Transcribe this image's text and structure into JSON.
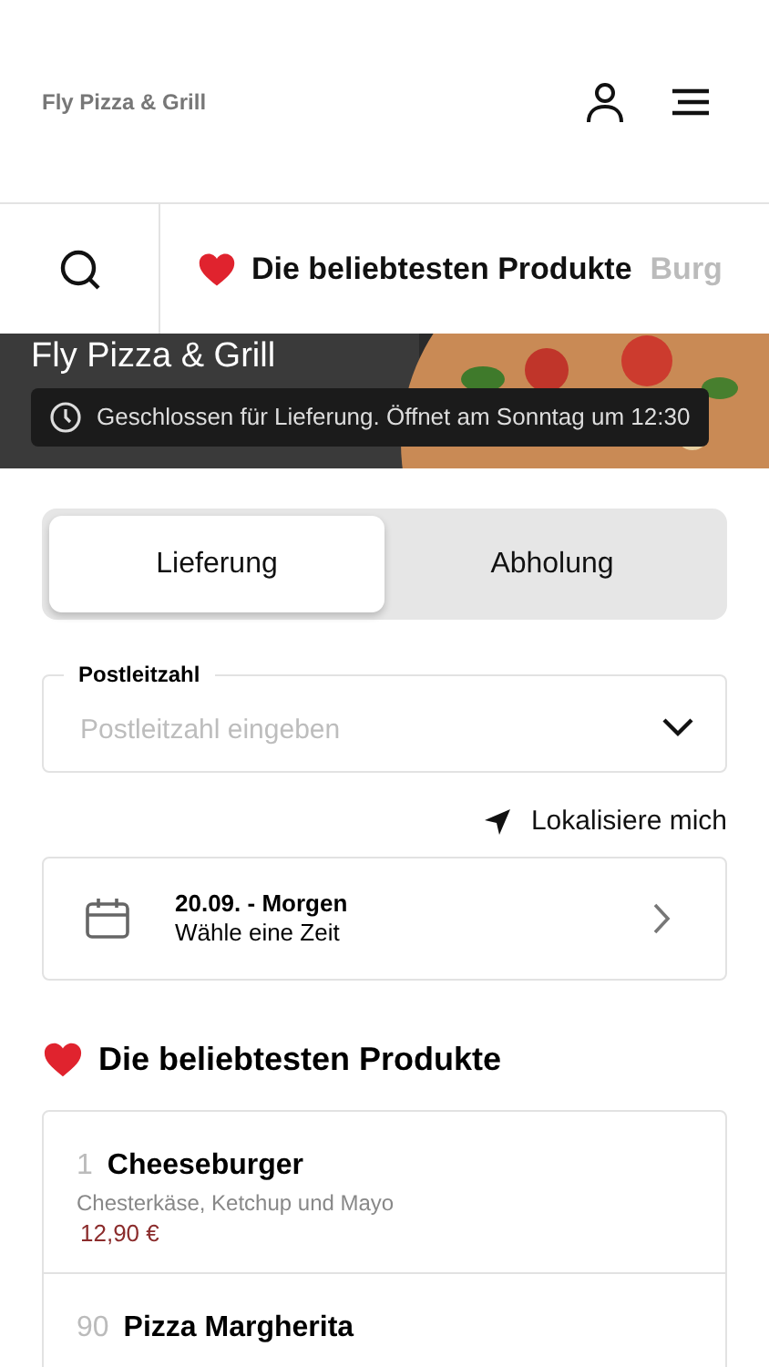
{
  "header": {
    "title": "Fly Pizza & Grill"
  },
  "category_bar": {
    "tabs": [
      {
        "label": "Die beliebtesten Produkte",
        "selected": true,
        "kind": "favorite"
      },
      {
        "label": "Burg",
        "selected": false,
        "kind": "plain"
      }
    ]
  },
  "hero": {
    "title": "Fly Pizza & Grill",
    "status": "Geschlossen für Lieferung. Öffnet am Sonntag um 12:30"
  },
  "mode_toggle": [
    {
      "label": "Lieferung",
      "selected": true
    },
    {
      "label": "Abholung",
      "selected": false
    }
  ],
  "postcode_field": {
    "label": "Postleitzahl",
    "placeholder": "Postleitzahl eingeben"
  },
  "locate_link": "Lokalisiere mich",
  "time_picker": {
    "date": "20.09. - Morgen",
    "hint": "Wähle eine Zeit"
  },
  "section_title": "Die beliebtesten Produkte",
  "products": [
    {
      "number": "1",
      "name": "Cheeseburger",
      "description": "Chesterkäse, Ketchup und Mayo",
      "price": "12,90 €"
    },
    {
      "number": "90",
      "name": "Pizza Margherita"
    }
  ]
}
